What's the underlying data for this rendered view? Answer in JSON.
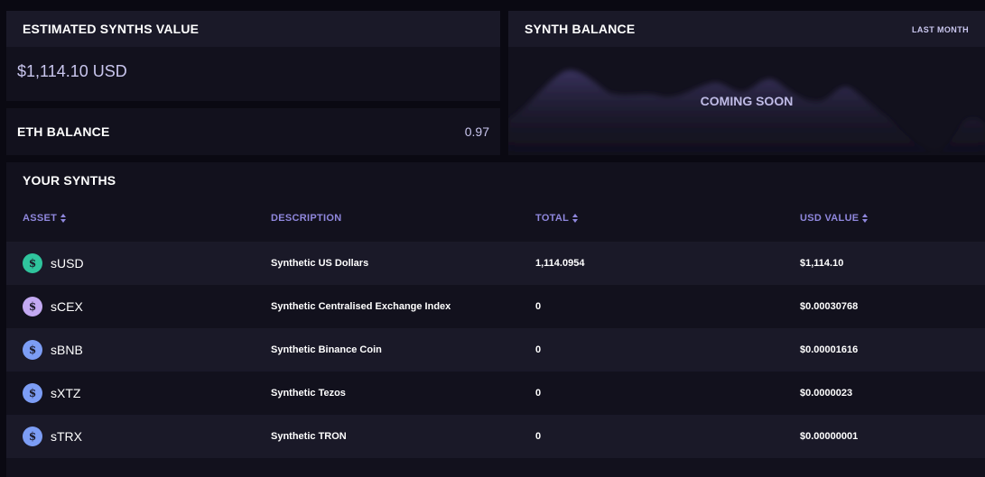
{
  "estimated": {
    "title": "ESTIMATED SYNTHS VALUE",
    "value": "$1,114.10 USD"
  },
  "eth": {
    "label": "ETH BALANCE",
    "value": "0.97"
  },
  "synth_balance": {
    "title": "SYNTH BALANCE",
    "range": "LAST MONTH",
    "coming_soon": "COMING SOON"
  },
  "synths": {
    "title": "YOUR SYNTHS",
    "columns": {
      "asset": "ASSET",
      "description": "DESCRIPTION",
      "total": "TOTAL",
      "usd_value": "USD VALUE"
    },
    "rows": [
      {
        "asset": "sUSD",
        "description": "Synthetic US Dollars",
        "total": "1,114.0954",
        "usd": "$1,114.10",
        "icon_color": "#2fc49d",
        "icon": "synth-logo-icon"
      },
      {
        "asset": "sCEX",
        "description": "Synthetic Centralised Exchange Index",
        "total": "0",
        "usd": "$0.00030768",
        "icon_color": "#c3a9f2",
        "icon": "synth-logo-icon"
      },
      {
        "asset": "sBNB",
        "description": "Synthetic Binance Coin",
        "total": "0",
        "usd": "$0.00001616",
        "icon_color": "#7c9df5",
        "icon": "synth-logo-icon"
      },
      {
        "asset": "sXTZ",
        "description": "Synthetic Tezos",
        "total": "0",
        "usd": "$0.0000023",
        "icon_color": "#7c9df5",
        "icon": "synth-logo-icon"
      },
      {
        "asset": "sTRX",
        "description": "Synthetic TRON",
        "total": "0",
        "usd": "$0.00000001",
        "icon_color": "#7c9df5",
        "icon": "synth-logo-icon"
      }
    ]
  },
  "colors": {
    "accent": "#8f87dd",
    "panel": "#12111d",
    "panel_alt": "#1a1928"
  }
}
